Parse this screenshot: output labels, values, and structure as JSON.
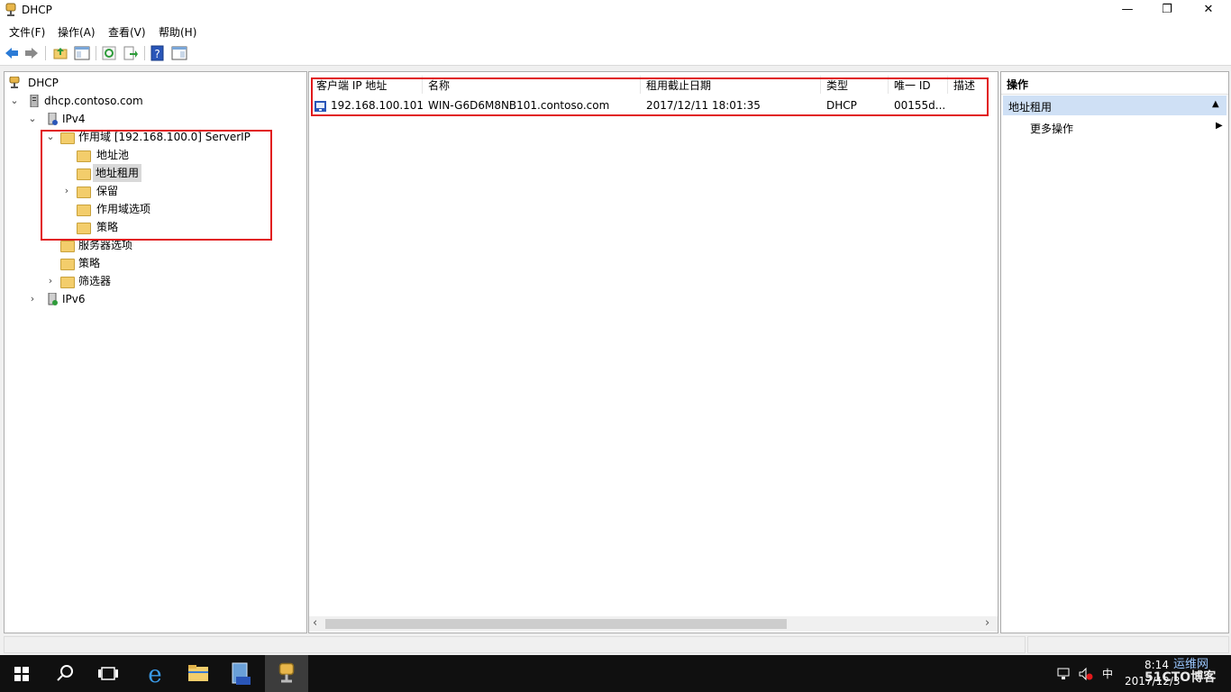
{
  "window": {
    "title": "DHCP",
    "min_glyph": "—",
    "restore_glyph": "❐",
    "close_glyph": "✕"
  },
  "menu": [
    "文件(F)",
    "操作(A)",
    "查看(V)",
    "帮助(H)"
  ],
  "toolbar": {
    "buttons": [
      "back-icon",
      "forward-icon",
      "up-folder-icon",
      "show-hide-tree-icon",
      "refresh-icon",
      "export-list-icon",
      "help-icon",
      "show-hide-action-pane-icon"
    ]
  },
  "tree": {
    "root": "DHCP",
    "server": "dhcp.contoso.com",
    "ipv4": "IPv4",
    "scope": "作用域 [192.168.100.0] ServerIP",
    "address_pool": "地址池",
    "address_leases": "地址租用",
    "reservations": "保留",
    "scope_options": "作用域选项",
    "scope_policies": "策略",
    "server_options": "服务器选项",
    "policies": "策略",
    "filters": "筛选器",
    "ipv6": "IPv6",
    "expanded_glyph": "⌄",
    "collapsed_glyph": "›"
  },
  "list": {
    "columns": [
      "客户端 IP 地址",
      "名称",
      "租用截止日期",
      "类型",
      "唯一 ID",
      "描述"
    ],
    "rows": [
      {
        "ip": "192.168.100.101",
        "name": "WIN-G6D6M8NB101.contoso.com",
        "expires": "2017/12/11 18:01:35",
        "type": "DHCP",
        "uid": "00155d...",
        "desc": ""
      }
    ],
    "scroll_left": "‹",
    "scroll_right": "›"
  },
  "actions": {
    "header": "操作",
    "section": "地址租用",
    "section_glyph": "▲",
    "more": "更多操作",
    "more_glyph": "▶"
  },
  "taskbar": {
    "ime": "中",
    "time": "8:14",
    "date": "2017/12/3",
    "watermark": "51CTO博客",
    "watermark2": "运维网"
  },
  "colors": {
    "highlight_box": "#e1191b",
    "action_section_bg": "#cfe0f5",
    "taskbar_bg": "#101010"
  }
}
